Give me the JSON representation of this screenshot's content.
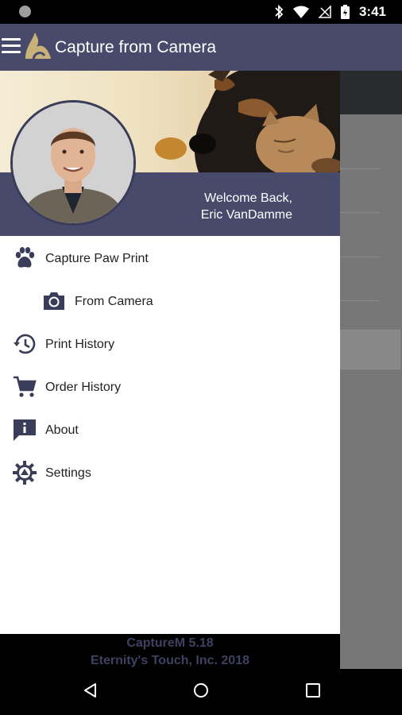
{
  "status_bar": {
    "time": "3:41"
  },
  "app_bar": {
    "title": "Capture from Camera"
  },
  "drawer": {
    "welcome_line1": "Welcome Back,",
    "welcome_line2": "Eric VanDamme",
    "menu": [
      {
        "label": "Capture Paw Print",
        "icon": "paw-icon"
      },
      {
        "label": "From Camera",
        "icon": "camera-icon"
      },
      {
        "label": "Print History",
        "icon": "history-icon"
      },
      {
        "label": "Order History",
        "icon": "cart-icon"
      },
      {
        "label": "About",
        "icon": "info-icon"
      },
      {
        "label": "Settings",
        "icon": "gear-icon"
      }
    ],
    "footer_line1": "CaptureM 5.18",
    "footer_line2": "Eternity's Touch, Inc. 2018"
  },
  "colors": {
    "primary": "#474a6a",
    "footer_text": "#3e4160"
  }
}
